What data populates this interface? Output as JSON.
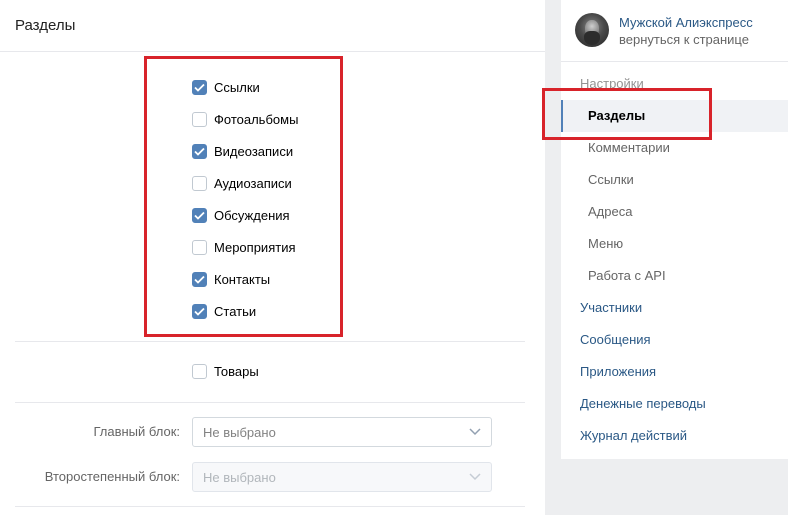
{
  "main": {
    "title": "Разделы",
    "sections": [
      {
        "label": "Ссылки",
        "checked": true
      },
      {
        "label": "Фотоальбомы",
        "checked": false
      },
      {
        "label": "Видеозаписи",
        "checked": true
      },
      {
        "label": "Аудиозаписи",
        "checked": false
      },
      {
        "label": "Обсуждения",
        "checked": true
      },
      {
        "label": "Мероприятия",
        "checked": false
      },
      {
        "label": "Контакты",
        "checked": true
      },
      {
        "label": "Статьи",
        "checked": true
      }
    ],
    "goods": {
      "label": "Товары",
      "checked": false
    },
    "main_block": {
      "label": "Главный блок:",
      "value": "Не выбрано"
    },
    "secondary_block": {
      "label": "Второстепенный блок:",
      "value": "Не выбрано"
    }
  },
  "profile": {
    "name": "Мужской Алиэкспресс",
    "back_link": "вернуться к странице"
  },
  "nav": {
    "settings": "Настройки",
    "sections": "Разделы",
    "comments": "Комментарии",
    "links": "Ссылки",
    "addresses": "Адреса",
    "menu": "Меню",
    "api": "Работа с API",
    "members": "Участники",
    "messages": "Сообщения",
    "apps": "Приложения",
    "money": "Денежные переводы",
    "log": "Журнал действий"
  },
  "colors": {
    "accent": "#5181b8",
    "link": "#2a5885",
    "highlight": "#d8232a"
  }
}
